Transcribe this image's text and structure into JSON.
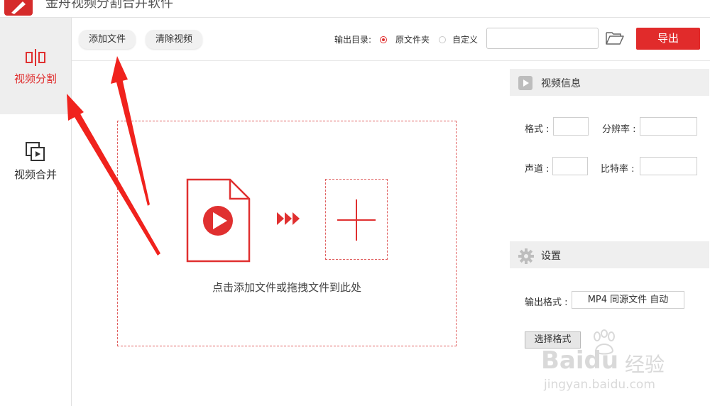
{
  "app": {
    "title": "金舟视频分割合并软件"
  },
  "sidebar": {
    "items": [
      {
        "label": "视频分割",
        "icon": "split-icon",
        "active": true
      },
      {
        "label": "视频合并",
        "icon": "merge-icon",
        "active": false
      }
    ]
  },
  "toolbar": {
    "add_file": "添加文件",
    "clear_video": "清除视频",
    "output_dir_label": "输出目录:",
    "radio_original": "原文件夹",
    "radio_custom": "自定义",
    "path_value": "",
    "export": "导出"
  },
  "dropzone": {
    "hint": "点击添加文件或拖拽文件到此处"
  },
  "video_info": {
    "title": "视频信息",
    "format_label": "格式 :",
    "resolution_label": "分辨率 :",
    "channel_label": "声道 :",
    "bitrate_label": "比特率 :",
    "format_value": "",
    "resolution_value": "",
    "channel_value": "",
    "bitrate_value": ""
  },
  "settings": {
    "title": "设置",
    "output_format_label": "输出格式 :",
    "output_format_value": "MP4 同源文件 自动",
    "select_format": "选择格式"
  },
  "watermark": {
    "brand": "Baidu",
    "brand_cn": "经验",
    "url": "jingyan.baidu.com"
  },
  "colors": {
    "accent": "#e12b2b",
    "sidebar_active_bg": "#eeeeee",
    "panel_header_bg": "#efefef"
  }
}
